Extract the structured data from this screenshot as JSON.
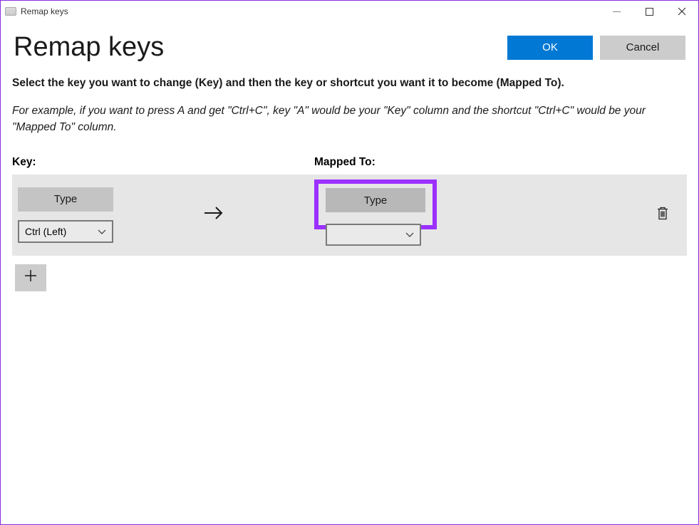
{
  "window": {
    "title": "Remap keys"
  },
  "header": {
    "title": "Remap keys",
    "ok_label": "OK",
    "cancel_label": "Cancel"
  },
  "instruction": "Select the key you want to change (Key) and then the key or shortcut you want it to become (Mapped To).",
  "example": "For example, if you want to press A and get \"Ctrl+C\", key \"A\" would be your \"Key\" column and the shortcut \"Ctrl+C\" would be your \"Mapped To\" column.",
  "columns": {
    "key_label": "Key:",
    "mapped_label": "Mapped To:"
  },
  "row": {
    "key_type_label": "Type",
    "key_selected": "Ctrl (Left)",
    "mapped_type_label": "Type",
    "mapped_selected": ""
  }
}
